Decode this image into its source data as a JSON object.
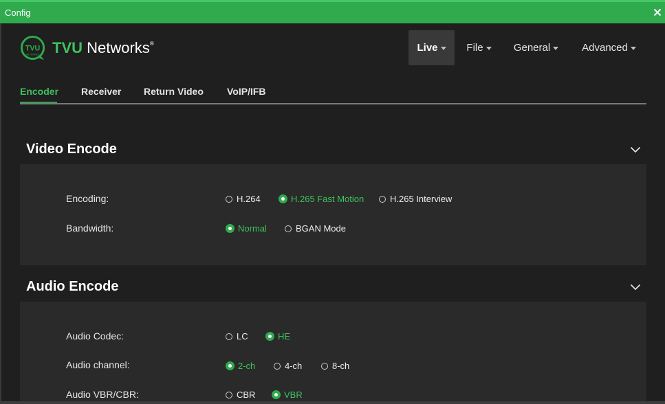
{
  "window": {
    "title": "Config",
    "close_icon": "close-icon"
  },
  "brand": {
    "logo_icon": "tvu-logo-icon",
    "name_part1": "TVU",
    "name_part2": "Networks",
    "trademark": "®"
  },
  "nav": [
    {
      "label": "Live",
      "active": true
    },
    {
      "label": "File",
      "active": false
    },
    {
      "label": "General",
      "active": false
    },
    {
      "label": "Advanced",
      "active": false
    }
  ],
  "tabs": [
    {
      "label": "Encoder",
      "active": true
    },
    {
      "label": "Receiver",
      "active": false
    },
    {
      "label": "Return Video",
      "active": false
    },
    {
      "label": "VoIP/IFB",
      "active": false
    }
  ],
  "video_encode": {
    "title": "Video Encode",
    "encoding": {
      "label": "Encoding:",
      "options": [
        "H.264",
        "H.265 Fast Motion",
        "H.265 Interview"
      ],
      "selected": "H.265 Fast Motion"
    },
    "bandwidth": {
      "label": "Bandwidth:",
      "options": [
        "Normal",
        "BGAN Mode"
      ],
      "selected": "Normal"
    }
  },
  "audio_encode": {
    "title": "Audio Encode",
    "codec": {
      "label": "Audio Codec:",
      "options": [
        "LC",
        "HE"
      ],
      "selected": "HE"
    },
    "channel": {
      "label": "Audio channel:",
      "options": [
        "2-ch",
        "4-ch",
        "8-ch"
      ],
      "selected": "2-ch"
    },
    "vbr_cbr": {
      "label": "Audio VBR/CBR:",
      "options": [
        "CBR",
        "VBR"
      ],
      "selected": "VBR"
    }
  },
  "colors": {
    "accent": "#2fab4e",
    "background": "#1f1f1f",
    "panel": "#2a2a2a",
    "nav_active": "#393939"
  }
}
